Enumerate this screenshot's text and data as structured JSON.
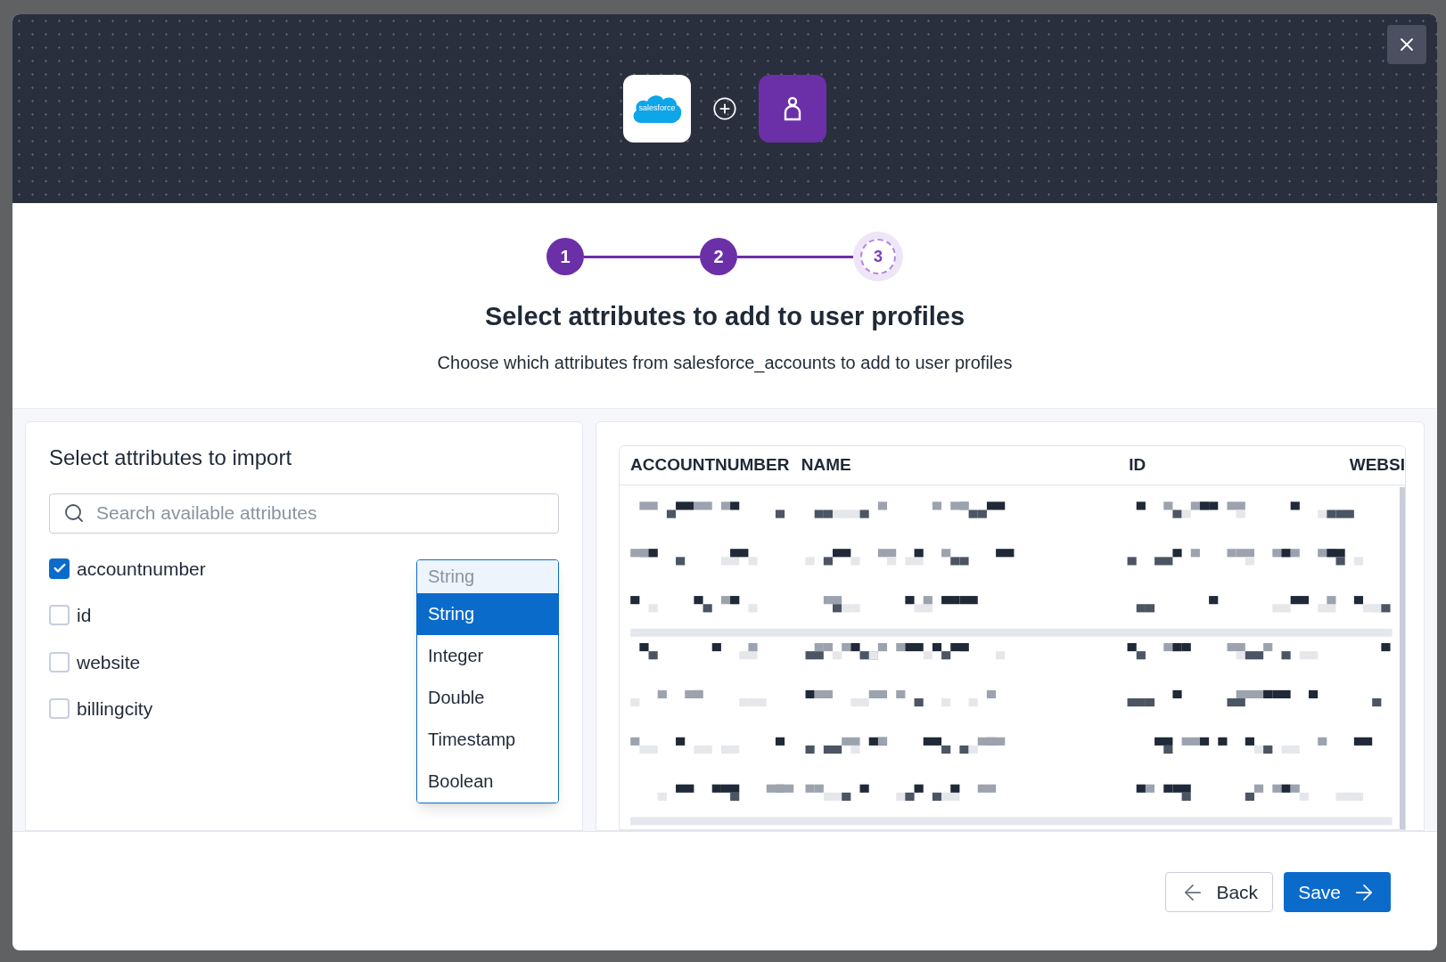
{
  "header": {
    "logo_text": "salesforce"
  },
  "stepper": [
    {
      "label": "1",
      "completed": true
    },
    {
      "label": "2",
      "completed": true
    },
    {
      "label": "3",
      "completed": false
    }
  ],
  "title": "Select attributes to add to user profiles",
  "subtitle": "Choose which attributes from salesforce_accounts to add to user profiles",
  "attributes_panel": {
    "title": "Select attributes to import",
    "search": {
      "placeholder": "Search available attributes"
    },
    "attributes": [
      {
        "label": "accountnumber",
        "checked": true
      },
      {
        "label": "id",
        "checked": false
      },
      {
        "label": "website",
        "checked": false
      },
      {
        "label": "billingcity",
        "checked": false
      }
    ],
    "type_dropdown": {
      "value": "String",
      "options": [
        {
          "label": "String",
          "selected": true
        },
        {
          "label": "Integer",
          "selected": false
        },
        {
          "label": "Double",
          "selected": false
        },
        {
          "label": "Timestamp",
          "selected": false
        },
        {
          "label": "Boolean",
          "selected": false
        }
      ]
    }
  },
  "preview_table": {
    "columns": [
      "ACCOUNTNUMBER",
      "NAME",
      "ID",
      "WEBSI"
    ]
  },
  "buttons": [
    {
      "label": "Back",
      "kind": "secondary"
    },
    {
      "label": "Save",
      "kind": "primary"
    }
  ]
}
